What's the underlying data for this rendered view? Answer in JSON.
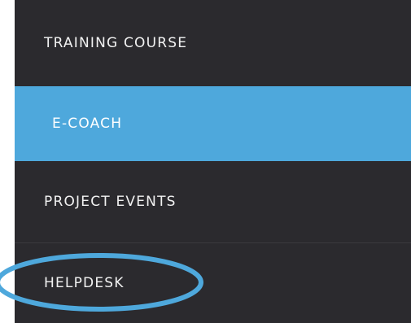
{
  "menu": {
    "items": [
      {
        "label": "TRAINING COURSE"
      },
      {
        "label": "E-COACH",
        "active": true
      },
      {
        "label": "PROJECT EVENTS"
      },
      {
        "label": "HELPDESK"
      }
    ]
  },
  "colors": {
    "menu_bg": "#2b2a2e",
    "active_bg": "#4ea8dc",
    "annotation_stroke": "#4ea8dc"
  }
}
